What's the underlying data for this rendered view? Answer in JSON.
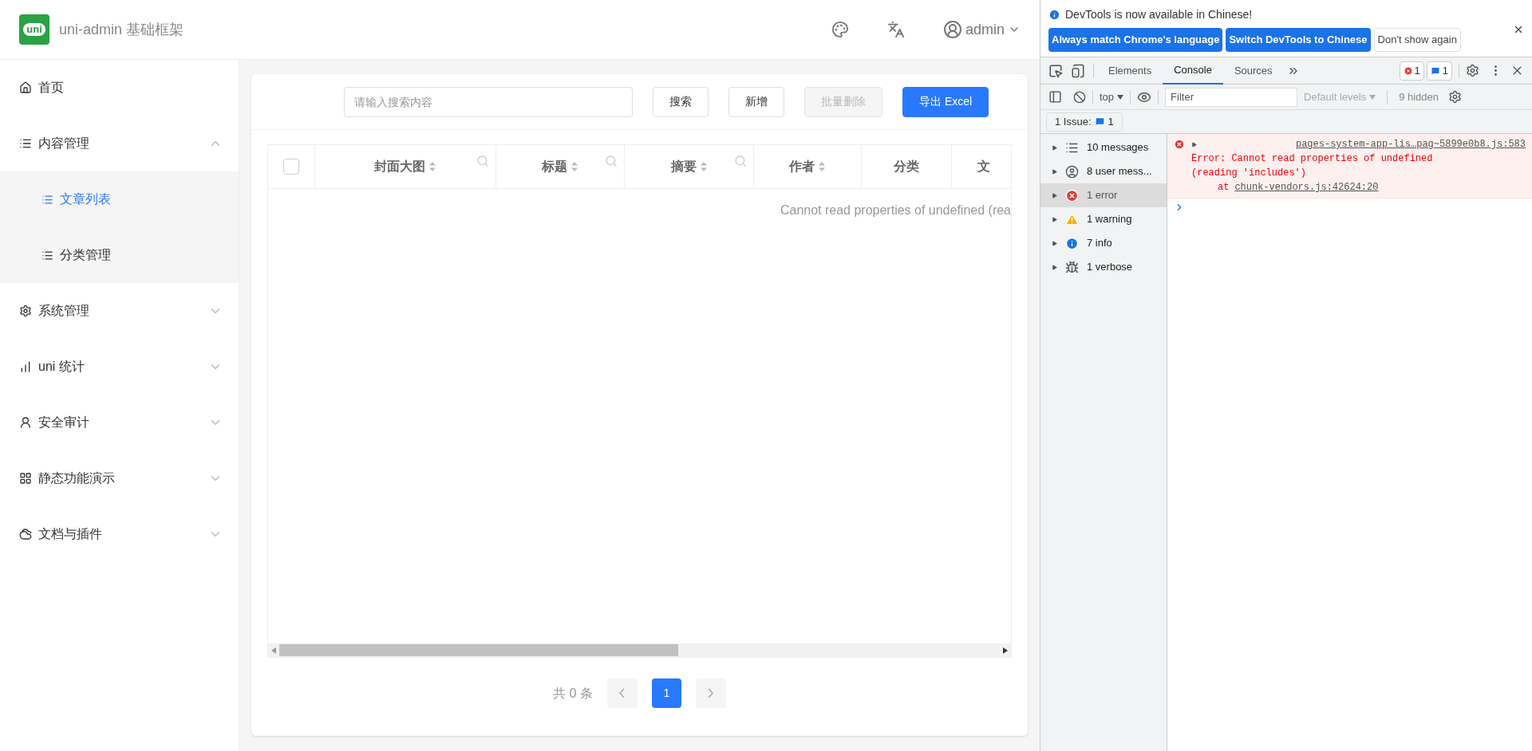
{
  "header": {
    "logo_text": "uni",
    "title": "uni-admin 基础框架",
    "user": "admin"
  },
  "sidebar": {
    "items": [
      {
        "label": "首页",
        "kind": "link",
        "selected": false
      },
      {
        "label": "内容管理",
        "kind": "group",
        "expanded": true,
        "children": [
          {
            "label": "文章列表",
            "selected": true
          },
          {
            "label": "分类管理",
            "selected": false
          }
        ]
      },
      {
        "label": "系统管理",
        "kind": "group",
        "expanded": false
      },
      {
        "label": "uni 统计",
        "kind": "group",
        "expanded": false
      },
      {
        "label": "安全审计",
        "kind": "group",
        "expanded": false
      },
      {
        "label": "静态功能演示",
        "kind": "group",
        "expanded": false
      },
      {
        "label": "文档与插件",
        "kind": "group",
        "expanded": false
      }
    ]
  },
  "toolbar": {
    "search": {
      "placeholder": "请输入搜索内容"
    },
    "buttons": [
      {
        "label": "搜索",
        "kind": "default"
      },
      {
        "label": "新增",
        "kind": "default"
      },
      {
        "label": "批量删除",
        "kind": "disabled"
      },
      {
        "label": "导出 Excel",
        "kind": "primary"
      }
    ]
  },
  "table": {
    "select_all": {
      "checked": false
    },
    "columns": [
      {
        "label": "封面大图",
        "sortable": true,
        "filterable": true
      },
      {
        "label": "标题",
        "sortable": true,
        "filterable": true
      },
      {
        "label": "摘要",
        "sortable": true,
        "filterable": true
      },
      {
        "label": "作者",
        "sortable": true,
        "filterable": false
      },
      {
        "label": "分类",
        "sortable": false,
        "filterable": false
      },
      {
        "label": "文",
        "sortable": false,
        "filterable": false
      }
    ],
    "empty_text": "Cannot read properties of undefined (rea"
  },
  "pagination": {
    "total": "共 0 条",
    "pages": [
      {
        "label": "1",
        "selected": true
      }
    ]
  },
  "devtools": {
    "banner": {
      "message": "DevTools is now available in Chinese!",
      "buttons": [
        {
          "label": "Always match Chrome's language",
          "kind": "primary"
        },
        {
          "label": "Switch DevTools to Chinese",
          "kind": "primary"
        },
        {
          "label": "Don't show again",
          "kind": "plain"
        }
      ]
    },
    "tabs": [
      {
        "label": "Elements",
        "selected": false
      },
      {
        "label": "Console",
        "selected": true
      },
      {
        "label": "Sources",
        "selected": false
      }
    ],
    "error_count": "1",
    "issue_count": "1",
    "console_toolbar": {
      "context": "top",
      "filter": {
        "placeholder": "Filter"
      },
      "levels": "Default levels",
      "hidden": "9 hidden"
    },
    "issues": {
      "label": "1 Issue:",
      "count": "1"
    },
    "sidebar": [
      {
        "label": "10 messages",
        "selected": false
      },
      {
        "label": "8 user mess...",
        "selected": false
      },
      {
        "label": "1 error",
        "selected": true
      },
      {
        "label": "1 warning",
        "selected": false
      },
      {
        "label": "7 info",
        "selected": false
      },
      {
        "label": "1 verbose",
        "selected": false
      }
    ],
    "messages": [
      {
        "kind": "error",
        "source": "pages-system-app-lis…pag~5899e0b8.js:583",
        "text": "Error: Cannot read properties of undefined (reading 'includes')",
        "at": "at",
        "link": "chunk-vendors.js:42624:20"
      }
    ]
  }
}
